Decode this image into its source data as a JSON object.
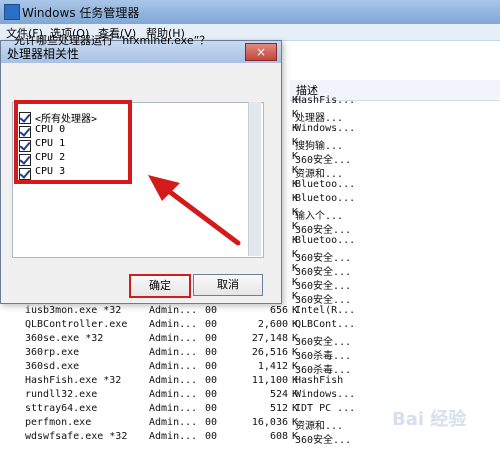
{
  "main_window": {
    "title": "Windows 任务管理器",
    "menu": [
      "文件(F)",
      "选项(O)",
      "查看(V)",
      "帮助(H)"
    ],
    "desc_header": "描述"
  },
  "dialog": {
    "title": "处理器相关性",
    "question": "允许哪些处理器运行 “hfxminer.exe”？",
    "items": [
      "<所有处理器>",
      "CPU 0",
      "CPU 1",
      "CPU 2",
      "CPU 3"
    ],
    "ok": "确定",
    "cancel": "取消",
    "close_glyph": "×"
  },
  "processes": [
    {
      "name": "",
      "user": "",
      "cpu": "",
      "mem": "",
      "k": "K",
      "desc": "HashFis..."
    },
    {
      "name": "",
      "user": "",
      "cpu": "",
      "mem": "",
      "k": "K",
      "desc": "处理器..."
    },
    {
      "name": "",
      "user": "",
      "cpu": "",
      "mem": "",
      "k": "K",
      "desc": "Windows..."
    },
    {
      "name": "",
      "user": "",
      "cpu": "",
      "mem": "",
      "k": "K",
      "desc": "搜狗输..."
    },
    {
      "name": "",
      "user": "",
      "cpu": "",
      "mem": "",
      "k": "K",
      "desc": "360安全..."
    },
    {
      "name": "",
      "user": "",
      "cpu": "",
      "mem": "",
      "k": "K",
      "desc": "资源和..."
    },
    {
      "name": "",
      "user": "",
      "cpu": "",
      "mem": "",
      "k": "K",
      "desc": "Bluetoo..."
    },
    {
      "name": "",
      "user": "",
      "cpu": "",
      "mem": "",
      "k": "K",
      "desc": "Bluetoo..."
    },
    {
      "name": "",
      "user": "",
      "cpu": "",
      "mem": "",
      "k": "K",
      "desc": "输入个..."
    },
    {
      "name": "",
      "user": "",
      "cpu": "",
      "mem": "",
      "k": "K",
      "desc": "360安全..."
    },
    {
      "name": "",
      "user": "",
      "cpu": "",
      "mem": "",
      "k": "K",
      "desc": "Bluetoo..."
    },
    {
      "name": "",
      "user": "",
      "cpu": "",
      "mem": "",
      "k": "K",
      "desc": "360安全..."
    },
    {
      "name": "",
      "user": "",
      "cpu": "",
      "mem": "",
      "k": "K",
      "desc": "360安全..."
    },
    {
      "name": "",
      "user": "",
      "cpu": "",
      "mem": "",
      "k": "K",
      "desc": "360安全..."
    },
    {
      "name": "",
      "user": "",
      "cpu": "",
      "mem": "",
      "k": "K",
      "desc": "360安全..."
    },
    {
      "name": "iusb3mon.exe *32",
      "user": "Admin...",
      "cpu": "00",
      "mem": "656",
      "k": "K",
      "desc": "Intel(R..."
    },
    {
      "name": "QLBController.exe",
      "user": "Admin...",
      "cpu": "00",
      "mem": "2,600",
      "k": "K",
      "desc": "QLBCont..."
    },
    {
      "name": "360se.exe *32",
      "user": "Admin...",
      "cpu": "00",
      "mem": "27,148",
      "k": "K",
      "desc": "360安全..."
    },
    {
      "name": "360rp.exe",
      "user": "Admin...",
      "cpu": "00",
      "mem": "26,516",
      "k": "K",
      "desc": "360杀毒..."
    },
    {
      "name": "360sd.exe",
      "user": "Admin...",
      "cpu": "00",
      "mem": "1,412",
      "k": "K",
      "desc": "360杀毒..."
    },
    {
      "name": "HashFish.exe *32",
      "user": "Admin...",
      "cpu": "00",
      "mem": "11,100",
      "k": "K",
      "desc": "HashFish"
    },
    {
      "name": "rundll32.exe",
      "user": "Admin...",
      "cpu": "00",
      "mem": "524",
      "k": "K",
      "desc": "Windows..."
    },
    {
      "name": "sttray64.exe",
      "user": "Admin...",
      "cpu": "00",
      "mem": "512",
      "k": "K",
      "desc": "IDT PC ..."
    },
    {
      "name": "perfmon.exe",
      "user": "Admin...",
      "cpu": "00",
      "mem": "16,036",
      "k": "K",
      "desc": "资源和..."
    },
    {
      "name": "wdswfsafe.exe *32",
      "user": "Admin...",
      "cpu": "00",
      "mem": "608",
      "k": "K",
      "desc": "360安全..."
    }
  ],
  "watermark": "Bai 经验"
}
